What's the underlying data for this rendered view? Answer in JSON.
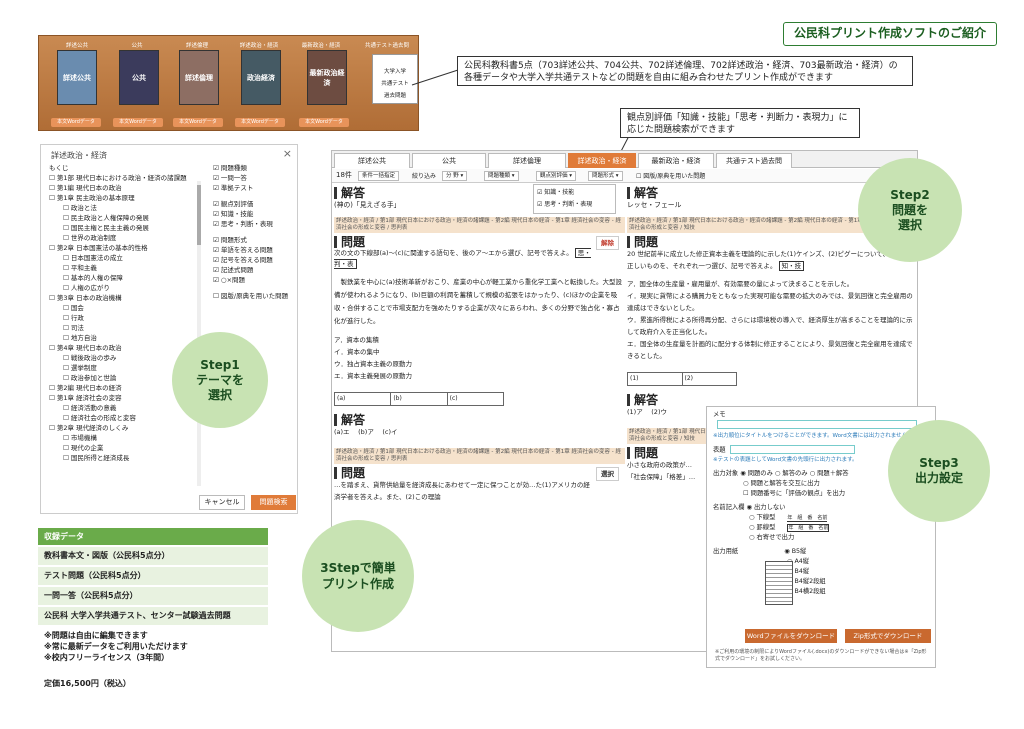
{
  "title": "公民科プリント作成ソフトのご紹介",
  "shelf": {
    "tabs": [
      "詳述公共",
      "公共",
      "詳述倫理",
      "詳述政治・経済",
      "最新政治・経済",
      "共通テスト過去問"
    ],
    "books": [
      "詳述公共",
      "公共",
      "詳述倫理",
      "政治経済",
      "最新政治経済"
    ],
    "dl": "本文Wordデータ",
    "kyotsu": [
      "大学入学",
      "共通テスト",
      "過去問題"
    ]
  },
  "note1": "公民科教科書5点（703詳述公共、704公共、702詳述倫理、702詳述政治・経済、703最新政治・経済）の各種データや大学入学共通テストなどの問題を自由に組み合わせたプリント作成ができます",
  "note2": "観点別評価「知識・技能」「思考・判断力・表現力」に応じた問題検索ができます",
  "left": {
    "title": "詳述政治・経済",
    "toc": "もくじ",
    "tree": [
      {
        "t": "☐ 第1部 現代日本における政治・経済の諸課題",
        "i": 0
      },
      {
        "t": "☐ 第1編 現代日本の政治",
        "i": 0
      },
      {
        "t": "☐ 第1章 民主政治の基本原理",
        "i": 0
      },
      {
        "t": "☐ 政治と法",
        "i": 1
      },
      {
        "t": "☐ 民主政治と人権保障の発展",
        "i": 1
      },
      {
        "t": "☐ 国民主権と民主主義の発展",
        "i": 1
      },
      {
        "t": "☐ 世界の政治制度",
        "i": 1
      },
      {
        "t": "☐ 第2章 日本国憲法の基本的性格",
        "i": 0
      },
      {
        "t": "☐ 日本国憲法の成立",
        "i": 1
      },
      {
        "t": "☐ 平和主義",
        "i": 1
      },
      {
        "t": "☐ 基本的人権の保障",
        "i": 1
      },
      {
        "t": "☐ 人権の広がり",
        "i": 1
      },
      {
        "t": "☐ 第3章 日本の政治機構",
        "i": 0
      },
      {
        "t": "☐ 国会",
        "i": 1
      },
      {
        "t": "☐ 行政",
        "i": 1
      },
      {
        "t": "☐ 司法",
        "i": 1
      },
      {
        "t": "☐ 地方自治",
        "i": 1
      },
      {
        "t": "☐ 第4章 現代日本の政治",
        "i": 0
      },
      {
        "t": "☐ 戦後政治の歩み",
        "i": 1
      },
      {
        "t": "☐ 選挙制度",
        "i": 1
      },
      {
        "t": "☐ 政治参加と世論",
        "i": 1
      },
      {
        "t": "☐ 第2編 現代日本の経済",
        "i": 0
      },
      {
        "t": "☐ 第1章 経済社会の変容",
        "i": 0
      },
      {
        "t": "☐ 経済活動の意義",
        "i": 1
      },
      {
        "t": "☐ 経済社会の形成と変容",
        "i": 1
      },
      {
        "t": "☐ 第2章 現代経済のしくみ",
        "i": 0
      },
      {
        "t": "☐ 市場機構",
        "i": 1
      },
      {
        "t": "☐ 現代の企業",
        "i": 1
      },
      {
        "t": "☐ 国民所得と経済成長",
        "i": 1
      }
    ],
    "opts": [
      "☑ 問題種類",
      "☑ 一問一答",
      "☑ 準拠テスト",
      "",
      "☑ 観点別評価",
      "☑ 知識・技能",
      "☑ 思考・判断・表現",
      "",
      "☑ 問題形式",
      "☑ 単語を答える問題",
      "☑ 記号を答える問題",
      "☑ 記述式問題",
      "☑ ○×問題",
      "",
      "☐ 図版/原典を用いた問題"
    ],
    "cancel": "キャンセル",
    "search": "問題検索"
  },
  "steps": {
    "s1": [
      "Step1",
      "テーマを",
      "選択"
    ],
    "s2": [
      "Step2",
      "問題を",
      "選択"
    ],
    "s3": [
      "Step3",
      "出力設定"
    ],
    "s4": [
      "3Stepで簡単",
      "プリント作成"
    ]
  },
  "info": {
    "head": "収録データ",
    "rows": [
      "教科書本文・図版（公民科5点分）",
      "テスト問題（公民科5点分）",
      "一問一答（公民科5点分）",
      "公民科 大学入学共通テスト、センター試験過去問題"
    ]
  },
  "notes": [
    "※問題は自由に編集できます",
    "※常に最新データをご利用いただけます",
    "※校内フリーライセンス（3年間）"
  ],
  "price": "定価16,500円（税込）",
  "main": {
    "tabs": [
      "詳述公共",
      "公共",
      "詳述倫理",
      "詳述政治・経済",
      "最新政治・経済",
      "共通テスト過去問"
    ],
    "toolbar": [
      "18件",
      "条件一括指定",
      "絞り込み",
      "分 野 ▾",
      "問題種類 ▾",
      "観点別評価 ▾",
      "問題形式 ▾",
      "☐ 図版/原典を用いた問題"
    ],
    "popup": [
      "☑ 知識・技能",
      "☑ 思考・判断・表現"
    ],
    "l": {
      "h1": "解答",
      "a1": "(神の)「見えざる手」",
      "band": "詳述政治・経済 / 第1部 現代日本における政治・経済の諸課題 - 第2編 現代日本の経済 - 第1章 経済社会の変容 - 経済社会の形成と変容 / 思判表",
      "h2": "問題",
      "kaito": "解除",
      "q": "次の文の下線部(a)〜(c)に関連する語句を、後のア〜エから選び、記号で答えよ。",
      "tag": "思・判・表",
      "body": "製鉄業を中心に(a)技術革新がおこり、産業の中心が軽工業から重化学工業へと転換した。大型設備が使われるようになり、(b)巨額の利潤を蓄積して規模の拡張をはかったり、(c)ほかの企業を吸収・合併することで市場支配力を強めたりする企業が次々にあらわれ、多くの分野で独占化・寡占化が進行した。",
      "opts": [
        "ア．資本の集積",
        "イ．資本の集中",
        "ウ．独占資本主義の原動力",
        "エ．資本主義発展の原動力"
      ],
      "cells": [
        "(a)",
        "(b)",
        "(c)"
      ],
      "h3": "解答",
      "a3": "(a)エ　 (b)ア　 (c)イ",
      "h4": "問題",
      "sel": "選択",
      "q4": "…を踏まえ、貨幣供給量を経済成長にあわせて一定に保つことが効…た(1)アメリカの経済学者を答えよ。また、(2)この理論"
    },
    "r": {
      "h1": "解答",
      "a1": "レッセ・フェール",
      "band": "詳述政治・経済 / 第1部 現代日本における政治・経済の諸課題 - 第2編 現代日本の経済 - 第1章 経済社会の変容 - 経済社会の形成と変容 / 知技",
      "h2": "問題",
      "kaito": "解除",
      "q": "20 世紀前半に成立した修正資本主義を理論的に示した(1)ケインズ、(2)ピグーについて、正しいものを、それぞれ一つ選び、記号で答えよ。",
      "tag": "知・技",
      "opts": [
        "ア．国全体の生産量・雇用量が、有効需要の量によって決まることを示した。",
        "イ．現実に貨幣による購買力をともなった実現可能な需要の拡大のみでは、景気回復と完全雇用の達成はできないとした。",
        "ウ．累進所得税による所得再分配、さらには環境税の導入で、経済厚生が高まることを理論的に示して政府介入を正当化した。",
        "エ．国全体の生産量を計画的に配分する体制に修正することにより、景気回復と完全雇用を達成できるとした。"
      ],
      "cells": [
        "(1)",
        "(2)"
      ],
      "h3": "解答",
      "a3": "(1)ア　 (2)ウ",
      "h4": "問題",
      "q4": "小さな政府の政策が…",
      "q5": "「社会保障」「格差」…"
    }
  },
  "out": {
    "memo": "メモ",
    "memo_hint": "※出力順位にタイトルをつけることができます。Word文書には出力されません。",
    "title": "表題",
    "title_hint": "※テストの表題としてWord文書の先頭行に出力されます。",
    "target": "出力対象",
    "t1": "◉ 問題のみ",
    "t2": "○ 解答のみ",
    "t3": "○ 問題＋解答",
    "t4": "○ 問題と解答を交互に出力",
    "t5": "☐ 問題番号に「評価の観点」を出力",
    "name": "名前記入欄",
    "n1": "◉ 出力しない",
    "n2": "○ 下線型",
    "n3": "○ 罫線型",
    "n4": "○ 右寄せで出力",
    "nfmt": "年　組　番　名前",
    "paper": "出力用紙",
    "p1": "◉ B5縦",
    "p2": "○ A4縦",
    "p3": "○ B4縦",
    "p4": "○ B4縦2段組",
    "p5": "○ B4横2段組",
    "word": "Wordファイルをダウンロード",
    "zip": "Zip形式でダウンロード",
    "foot": "※ご利用の環境の制限によりWordファイル(.docx)のダウンロードができない場合は※「Zip形式でダウンロード」をお試しください。"
  }
}
